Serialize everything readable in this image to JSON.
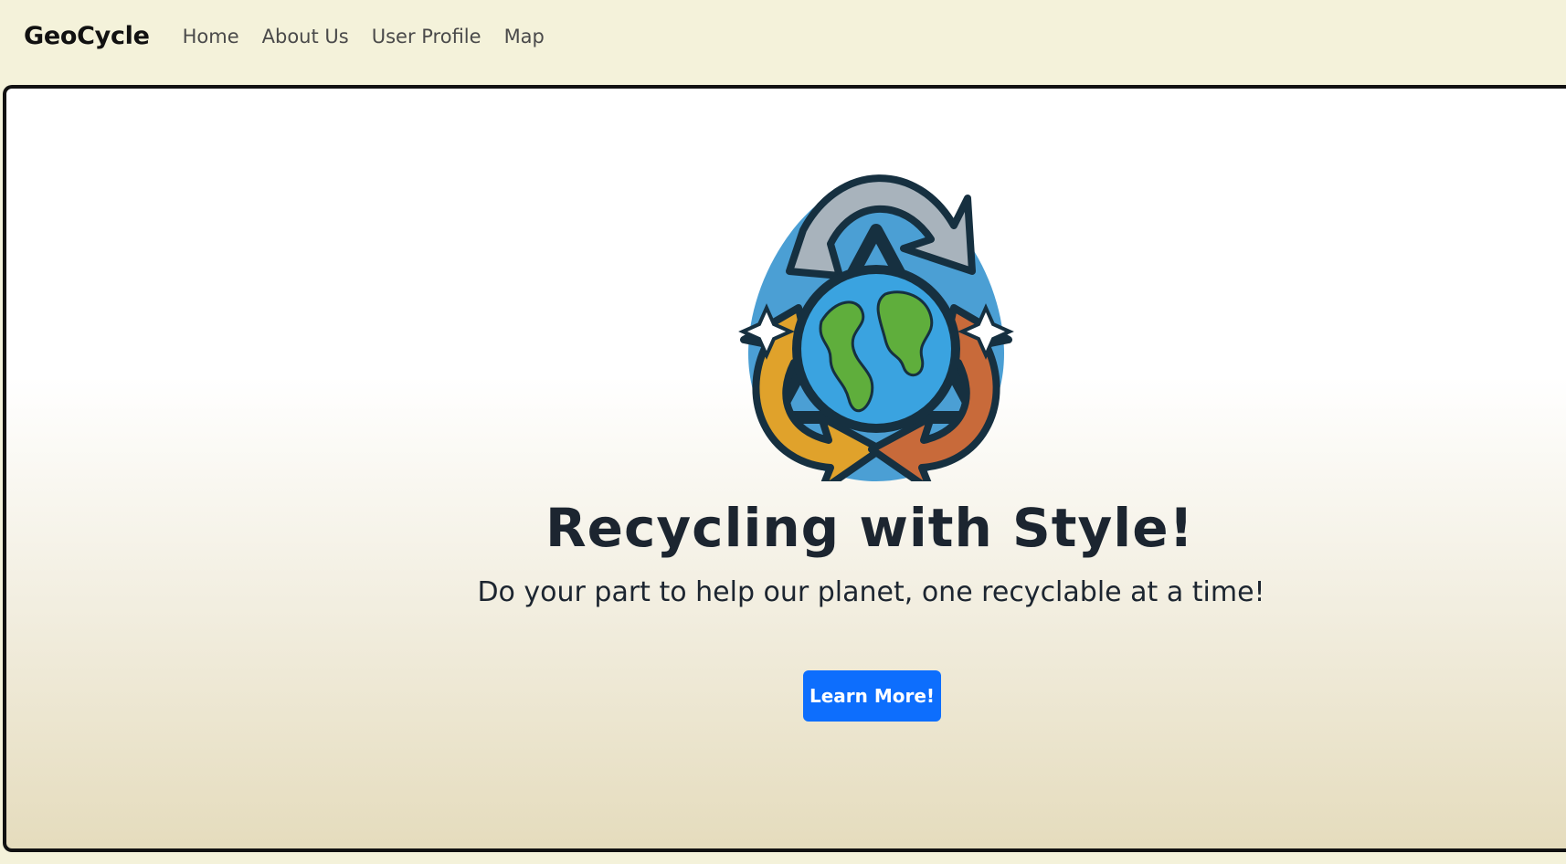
{
  "navbar": {
    "brand": "GeoCycle",
    "links": [
      "Home",
      "About Us",
      "User Profile",
      "Map"
    ]
  },
  "hero": {
    "logo_icon": "earth-recycle-logo-icon",
    "headline": "Recycling with Style!",
    "subtitle": "Do your part to help our planet, one recyclable at a time!",
    "cta_label": "Learn More!"
  },
  "colors": {
    "background": "#f4f2da",
    "button": "#0d6efd",
    "text": "#1c2530"
  }
}
